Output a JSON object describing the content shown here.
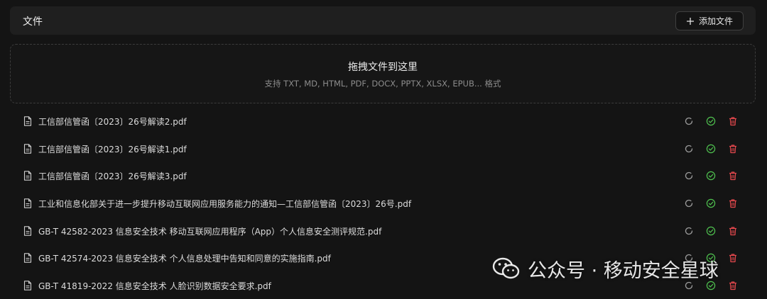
{
  "header": {
    "title": "文件",
    "add_button_label": "添加文件",
    "add_icon": "plus-icon"
  },
  "dropzone": {
    "title": "拖拽文件到这里",
    "subtitle": "支持 TXT, MD, HTML, PDF, DOCX, PPTX, XLSX, EPUB... 格式"
  },
  "files": [
    {
      "name": "工信部信管函〔2023〕26号解读2.pdf"
    },
    {
      "name": "工信部信管函〔2023〕26号解读1.pdf"
    },
    {
      "name": "工信部信管函〔2023〕26号解读3.pdf"
    },
    {
      "name": "工业和信息化部关于进一步提升移动互联网应用服务能力的通知—工信部信管函〔2023〕26号.pdf"
    },
    {
      "name": "GB-T 42582-2023 信息安全技术 移动互联网应用程序（App）个人信息安全测评规范.pdf"
    },
    {
      "name": "GB-T 42574-2023 信息安全技术 个人信息处理中告知和同意的实施指南.pdf"
    },
    {
      "name": "GB-T 41819-2022 信息安全技术 人脸识别数据安全要求.pdf"
    }
  ],
  "row_actions": {
    "refresh_icon": "refresh-icon",
    "status_icon": "check-circle-icon",
    "delete_icon": "trash-icon"
  },
  "colors": {
    "success": "#4fc24f",
    "danger": "#e5484d",
    "muted_icon": "#9a9a9a"
  },
  "watermark": {
    "text": "公众号 · 移动安全星球",
    "logo_icon": "wechat-logo"
  }
}
